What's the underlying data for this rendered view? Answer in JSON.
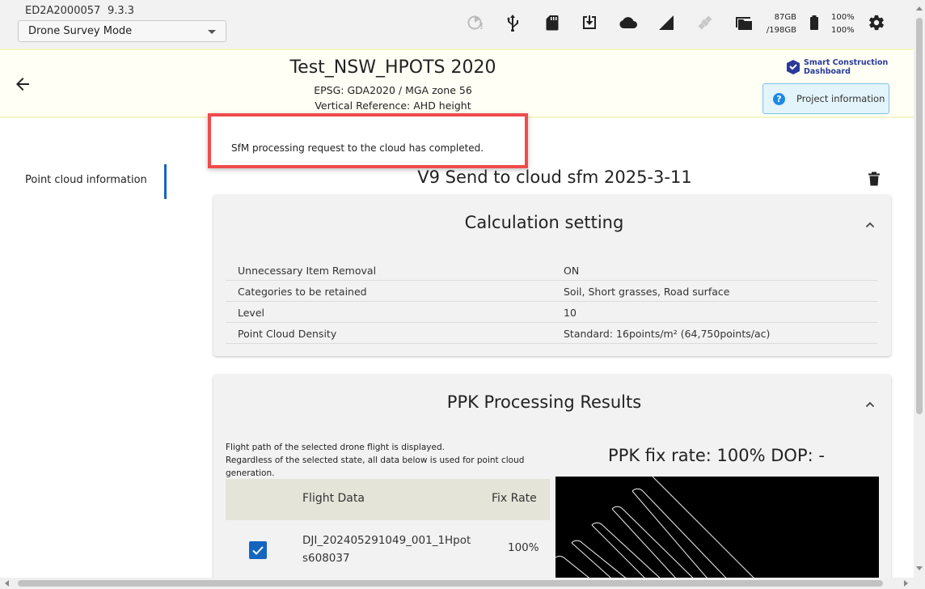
{
  "status_bar": {
    "device_id": "ED2A2000057",
    "version": "9.3.3",
    "mode": "Drone Survey Mode",
    "storage_free": "87GB",
    "storage_total": "/198GB",
    "battery_1": "100%",
    "battery_2": "100%",
    "icons": [
      "sync-pending-icon",
      "usb-icon",
      "sd-card-icon",
      "download-icon",
      "cloud-icon",
      "signal-icon",
      "satellite-icon",
      "folder-icon",
      "battery-icon",
      "settings-icon"
    ]
  },
  "project": {
    "title": "Test_NSW_HPOTS 2020",
    "epsg": "EPSG: GDA2020 / MGA zone 56",
    "vertical_reference": "Vertical Reference: AHD height",
    "logo_line1": "Smart Construction",
    "logo_line2": "Dashboard",
    "info_button": "Project information"
  },
  "toast": {
    "message": "SfM processing request to the cloud has completed."
  },
  "sidebar": {
    "items": [
      {
        "label": "Point cloud information",
        "active": true
      }
    ]
  },
  "dataset": {
    "title": "V9 Send to cloud sfm 2025-3-11"
  },
  "calculation": {
    "title": "Calculation setting",
    "rows": [
      {
        "key": "Unnecessary Item Removal",
        "value": "ON"
      },
      {
        "key": "Categories to be retained",
        "value": "Soil, Short grasses, Road surface"
      },
      {
        "key": "Level",
        "value": "10"
      },
      {
        "key": "Point Cloud Density",
        "value": "Standard: 16points/m² (64,750points/ac)"
      }
    ]
  },
  "ppk": {
    "title": "PPK Processing Results",
    "note_line1": "Flight path of the selected drone flight is displayed.",
    "note_line2": "Regardless of the selected state, all data below is used for point cloud generation.",
    "columns": {
      "flight": "Flight Data",
      "fix_rate": "Fix Rate"
    },
    "rows": [
      {
        "checked": true,
        "name": "DJI_202405291049_001_1Hpots608037",
        "fix_rate": "100%"
      }
    ],
    "fix_summary": "PPK fix rate: 100%   DOP: -"
  },
  "colors": {
    "accent": "#1565c0",
    "highlight_border": "#f04b4b",
    "header_bg": "#fffff5"
  }
}
